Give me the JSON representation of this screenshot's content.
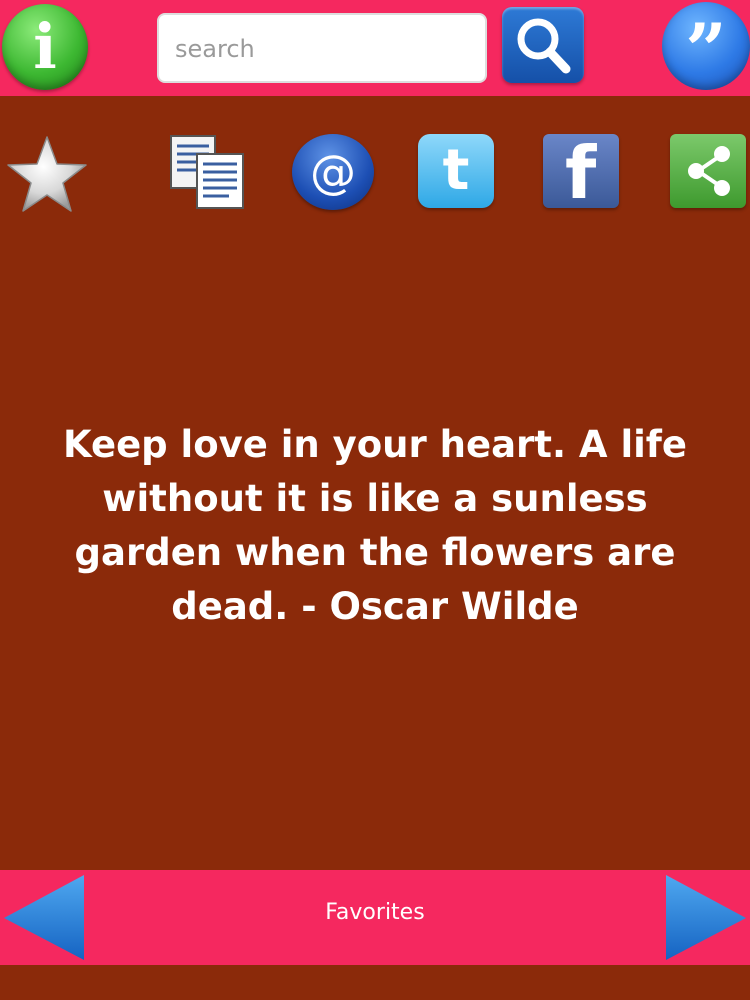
{
  "header": {
    "info_glyph": "i",
    "search": {
      "placeholder": "search",
      "value": ""
    },
    "quotes_glyph": "”"
  },
  "share_bar": {
    "icons": [
      "star-icon",
      "copy-icon",
      "email-icon",
      "twitter-icon",
      "facebook-icon",
      "share-icon"
    ],
    "email_glyph": "@",
    "twitter_glyph": "t",
    "facebook_glyph": "f"
  },
  "quote": {
    "text": "Keep love in your heart. A life without it is like a sunless garden when the flowers are dead. - Oscar Wilde"
  },
  "footer": {
    "favorites_label": "Favorites"
  },
  "colors": {
    "bar": "#F5285F",
    "background": "#8B2A0A",
    "arrow": "#1E7FD8"
  }
}
